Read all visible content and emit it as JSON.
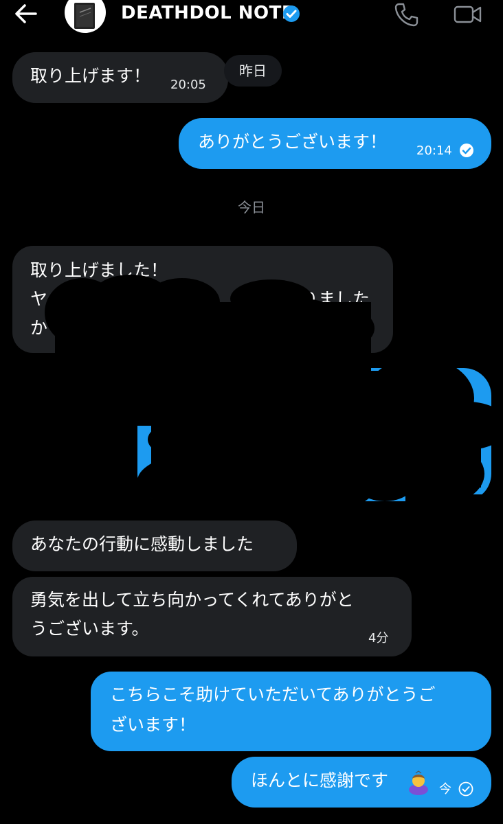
{
  "header": {
    "title": "DEATHDOL NOTE",
    "icons": [
      "back-arrow-icon",
      "notebook-avatar",
      "verified-badge-icon",
      "phone-icon",
      "video-icon"
    ],
    "colors": {
      "accent": "#1d9bf0",
      "background": "#000000",
      "incoming_bubble": "#1f2124"
    }
  },
  "messages": {
    "m1": {
      "text": "取り上げます！",
      "time": "20:05"
    },
    "day_yesterday": "昨日",
    "m2": {
      "text": "ありがとうございます！",
      "time": "20:14"
    },
    "day_today": "今日",
    "m3": {
      "line1": "取り上げました！",
      "line2_start": "ヤ",
      "line2_end": "りました",
      "line3_start": "か"
    },
    "m5": {
      "text": "あなたの行動に感動しました"
    },
    "m6": {
      "line1": "勇気を出して立ち向かってくれてありがと",
      "line2": "うございます。",
      "time": "4分"
    },
    "m7": {
      "line1": "こちらこそ助けていただいてありがとうご",
      "line2": "ざいます！"
    },
    "m8": {
      "text": "ほんとに感謝です",
      "time": "今"
    }
  }
}
